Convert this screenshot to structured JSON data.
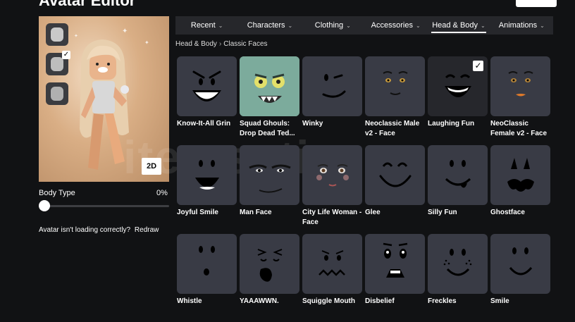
{
  "page": {
    "title": "Avatar Editor"
  },
  "avatar": {
    "view_toggle_label": "2D",
    "body_type_label": "Body Type",
    "body_type_value": "0%",
    "body_type_fraction": 0,
    "loading_message": "Avatar isn't loading correctly?",
    "redraw_label": "Redraw"
  },
  "tabs": [
    {
      "label": "Recent",
      "active": false
    },
    {
      "label": "Characters",
      "active": false
    },
    {
      "label": "Clothing",
      "active": false
    },
    {
      "label": "Accessories",
      "active": false
    },
    {
      "label": "Head & Body",
      "active": true
    },
    {
      "label": "Animations",
      "active": false
    }
  ],
  "breadcrumb": {
    "parent": "Head & Body",
    "current": "Classic Faces"
  },
  "items": [
    {
      "name": "Know-It-All Grin",
      "selected": false
    },
    {
      "name": "Squad Ghouls: Drop Dead Ted...",
      "selected": false
    },
    {
      "name": "Winky",
      "selected": false
    },
    {
      "name": "Neoclassic Male v2 - Face",
      "selected": false
    },
    {
      "name": "Laughing Fun",
      "selected": true
    },
    {
      "name": "NeoClassic Female v2 - Face",
      "selected": false
    },
    {
      "name": "Joyful Smile",
      "selected": false
    },
    {
      "name": "Man Face",
      "selected": false
    },
    {
      "name": "City Life Woman - Face",
      "selected": false
    },
    {
      "name": "Glee",
      "selected": false
    },
    {
      "name": "Silly Fun",
      "selected": false
    },
    {
      "name": "Ghostface",
      "selected": false
    },
    {
      "name": "Whistle",
      "selected": false
    },
    {
      "name": "YAAAWWN.",
      "selected": false
    },
    {
      "name": "Squiggle Mouth",
      "selected": false
    },
    {
      "name": "Disbelief",
      "selected": false
    },
    {
      "name": "Freckles",
      "selected": false
    },
    {
      "name": "Smile",
      "selected": false
    }
  ],
  "watermark": "itemsatis",
  "colors": {
    "background": "#111214",
    "tile": "#393b45",
    "tab_bar": "#26272b",
    "accent": "#ffffff"
  }
}
